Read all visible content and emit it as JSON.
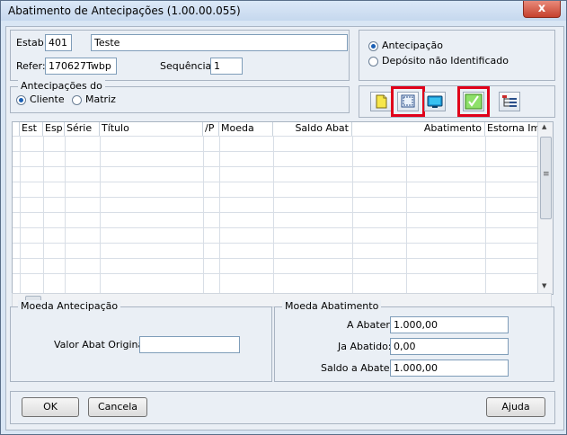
{
  "window": {
    "title": "Abatimento de Antecipações (1.00.00.055)",
    "close_glyph": "x"
  },
  "header": {
    "estab_label": "Estab:",
    "estab_value": "401",
    "estab_name": "Teste",
    "refer_label": "Refer:",
    "refer_value": "170627Twbp",
    "sequencia_label": "Sequência:",
    "sequencia_value": "1"
  },
  "tipo": {
    "options": [
      "Antecipação",
      "Depósito não Identificado"
    ],
    "selected": "Antecipação"
  },
  "antecipacoes_do": {
    "legend": "Antecipações do",
    "options": [
      "Cliente",
      "Matriz"
    ],
    "selected": "Cliente"
  },
  "toolbar": {
    "buttons": [
      {
        "icon": "new-document-icon",
        "highlighted": false
      },
      {
        "icon": "select-all-icon",
        "highlighted": true
      },
      {
        "icon": "monitor-icon",
        "highlighted": false
      },
      {
        "icon": "checkmark-icon",
        "highlighted": true
      },
      {
        "icon": "tree-list-icon",
        "highlighted": false
      }
    ]
  },
  "grid": {
    "columns": [
      "Est",
      "Esp",
      "Série",
      "Título",
      "/P",
      "Moeda",
      "Saldo Abat",
      "Abatimento",
      "Estorna Impl"
    ],
    "scroll_arrows": {
      "up": "▲",
      "down": "▼",
      "grip": "≡"
    }
  },
  "moeda_antecipacao": {
    "legend": "Moeda Antecipação",
    "valor_label": "Valor Abat Original:",
    "valor_value": ""
  },
  "moeda_abatimento": {
    "legend": "Moeda Abatimento",
    "a_abater_label": "A Abater:",
    "a_abater_value": "1.000,00",
    "ja_abatido_label": "Ja Abatido:",
    "ja_abatido_value": "0,00",
    "saldo_label": "Saldo a Abater:",
    "saldo_value": "1.000,00"
  },
  "footer": {
    "ok": "OK",
    "cancel": "Cancela",
    "help": "Ajuda"
  }
}
